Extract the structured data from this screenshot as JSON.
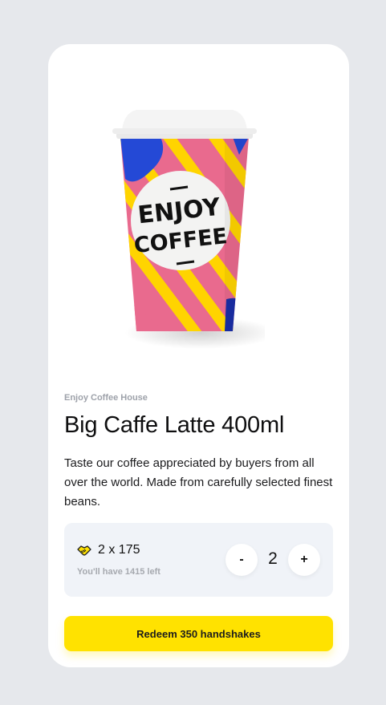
{
  "product": {
    "brand": "Enjoy Coffee House",
    "title": "Big Caffe Latte 400ml",
    "description": "Taste our coffee appreciated by buyers from all over the world. Made from carefully selected finest beans.",
    "image_alt": "Enjoy Coffee cup",
    "cup_text_line1": "ENJOY",
    "cup_text_line2": "COFFEE"
  },
  "redeem": {
    "icon": "handshake-icon",
    "points_label": "2 x 175",
    "remaining_label": "You'll have 1415 left",
    "minus_label": "-",
    "plus_label": "+",
    "quantity": "2"
  },
  "cta": {
    "label": "Redeem 350 handshakes"
  },
  "colors": {
    "background": "#e6e8ec",
    "card": "#ffffff",
    "panel": "#f0f3f8",
    "accent_yellow": "#ffe200",
    "cup_pink": "#e96a8e",
    "cup_blue": "#2449d6",
    "cup_yellow": "#ffd400"
  }
}
